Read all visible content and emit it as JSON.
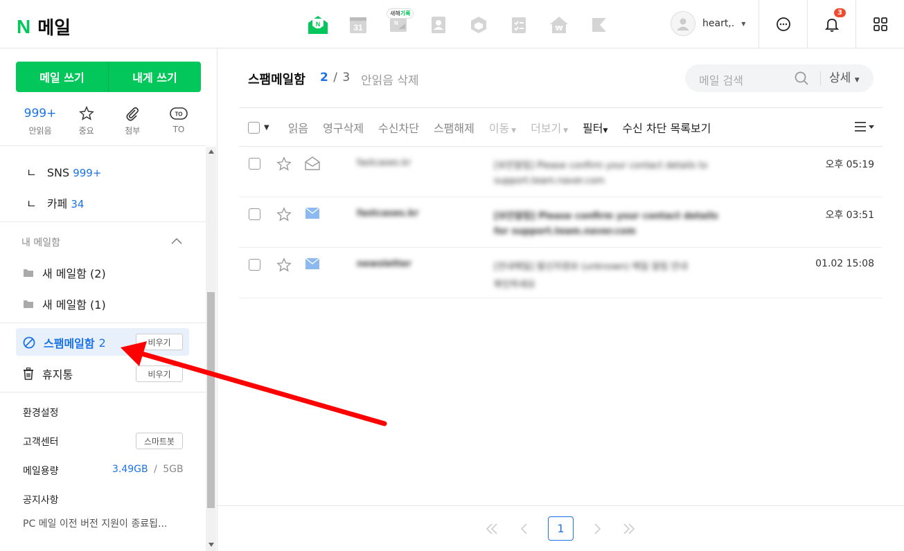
{
  "header": {
    "logo_letter": "N",
    "logo_text": "메일",
    "apps": [
      {
        "icon": "mail-open-icon"
      },
      {
        "icon": "calendar-icon",
        "label": "31"
      },
      {
        "icon": "memo-icon",
        "pill_prefix": "새해",
        "pill_highlight": "기록"
      },
      {
        "icon": "contacts-icon"
      },
      {
        "icon": "box-icon"
      },
      {
        "icon": "checklist-icon"
      },
      {
        "icon": "house-price-icon"
      },
      {
        "icon": "bookmark-icon"
      }
    ],
    "user_name": "heart,.",
    "notification_count": "3"
  },
  "sidebar": {
    "compose_label": "메일 쓰기",
    "self_compose_label": "내게 쓰기",
    "quick": [
      {
        "top": "999+",
        "label": "안읽음"
      },
      {
        "icon": "star-icon",
        "label": "중요"
      },
      {
        "icon": "paperclip-icon",
        "label": "첨부"
      },
      {
        "icon": "to-icon",
        "label": "TO"
      }
    ],
    "sub_items": [
      {
        "prefix": "ㄴ",
        "label": "SNS",
        "count": "999+"
      },
      {
        "prefix": "ㄴ",
        "label": "카페",
        "count": "34"
      }
    ],
    "my_mailbox_title": "내 메일함",
    "folders": [
      {
        "label": "새 메일함 (2)"
      },
      {
        "label": "새 메일함 (1)"
      }
    ],
    "spam": {
      "label": "스팸메일함",
      "count": "2",
      "empty_label": "비우기"
    },
    "trash": {
      "label": "휴지통",
      "empty_label": "비우기"
    },
    "settings_label": "환경설정",
    "support_label": "고객센터",
    "smartbot_label": "스마트봇",
    "storage_label": "메일용량",
    "storage_used": "3.49GB",
    "storage_sep": "/",
    "storage_total": "5GB",
    "notice_label": "공지사항",
    "notice_text": "PC 메일 이전 버전 지원이 종료됩..."
  },
  "main": {
    "title": "스팸메일함",
    "unread": "2",
    "sep": "/",
    "total": "3",
    "mark_read_delete": "안읽음 삭제",
    "search_placeholder": "메일 검색",
    "search_detail": "상세",
    "toolbar": {
      "read": "읽음",
      "delete_forever": "영구삭제",
      "block": "수신차단",
      "unspam": "스팸해제",
      "move": "이동",
      "more": "더보기",
      "filter": "필터",
      "block_list": "수신 차단 목록보기"
    },
    "mails": [
      {
        "sender": "fastcases.kr",
        "subject": "[보안알림] Please confirm your contact details to",
        "subject2": "support.team.naver.com",
        "time": "오후 05:19",
        "read": true
      },
      {
        "sender": "fastcases.kr",
        "subject": "[보안알림] Please confirm your contact details",
        "subject2": "for support.team.naver.com",
        "time": "오후 03:51",
        "read": false
      },
      {
        "sender": "newsletter",
        "subject": "[안내메일] 발신자정보 (unknown) 메일 알림 안내",
        "subject2": "확인하세요",
        "time": "01.02 15:08",
        "read": false
      }
    ],
    "pager": {
      "current": "1"
    }
  },
  "colors": {
    "brand": "#03c75a",
    "accent": "#1a73e8",
    "badge": "#f04b2d",
    "annotation_arrow": "#ff0000"
  }
}
